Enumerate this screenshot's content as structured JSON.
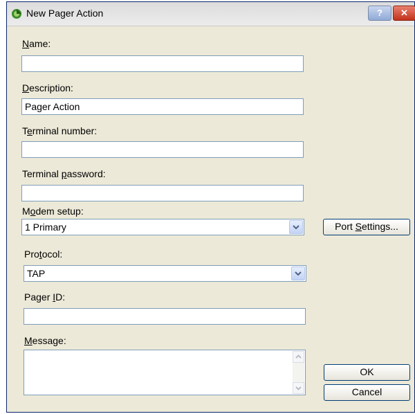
{
  "window": {
    "title": "New Pager Action",
    "help_label": "?",
    "close_label": "✕"
  },
  "form": {
    "name": {
      "label_key": "N",
      "label_rest": "ame:",
      "value": ""
    },
    "description": {
      "label_key": "D",
      "label_rest": "escription:",
      "value": "Pager Action"
    },
    "terminal_number": {
      "label_pre": "T",
      "label_key": "e",
      "label_rest": "rminal number:",
      "value": ""
    },
    "terminal_password": {
      "label_pre": "Terminal ",
      "label_key": "p",
      "label_rest": "assword:",
      "value": ""
    },
    "modem_setup": {
      "label_pre": "M",
      "label_key": "o",
      "label_rest": "dem setup:",
      "value": "1 Primary"
    },
    "protocol": {
      "label_pre": "Pro",
      "label_key": "t",
      "label_rest": "ocol:",
      "value": "TAP"
    },
    "pager_id": {
      "label_pre": "Pager ",
      "label_key": "I",
      "label_rest": "D:",
      "value": ""
    },
    "message": {
      "label_key": "M",
      "label_rest": "essage:",
      "value": ""
    }
  },
  "buttons": {
    "port_settings": {
      "pre": "Port ",
      "key": "S",
      "rest": "ettings..."
    },
    "ok": "OK",
    "cancel": "Cancel"
  },
  "icons": [
    "app-icon",
    "help-icon",
    "close-icon",
    "chevron-down-icon",
    "scroll-up-icon",
    "scroll-down-icon"
  ]
}
